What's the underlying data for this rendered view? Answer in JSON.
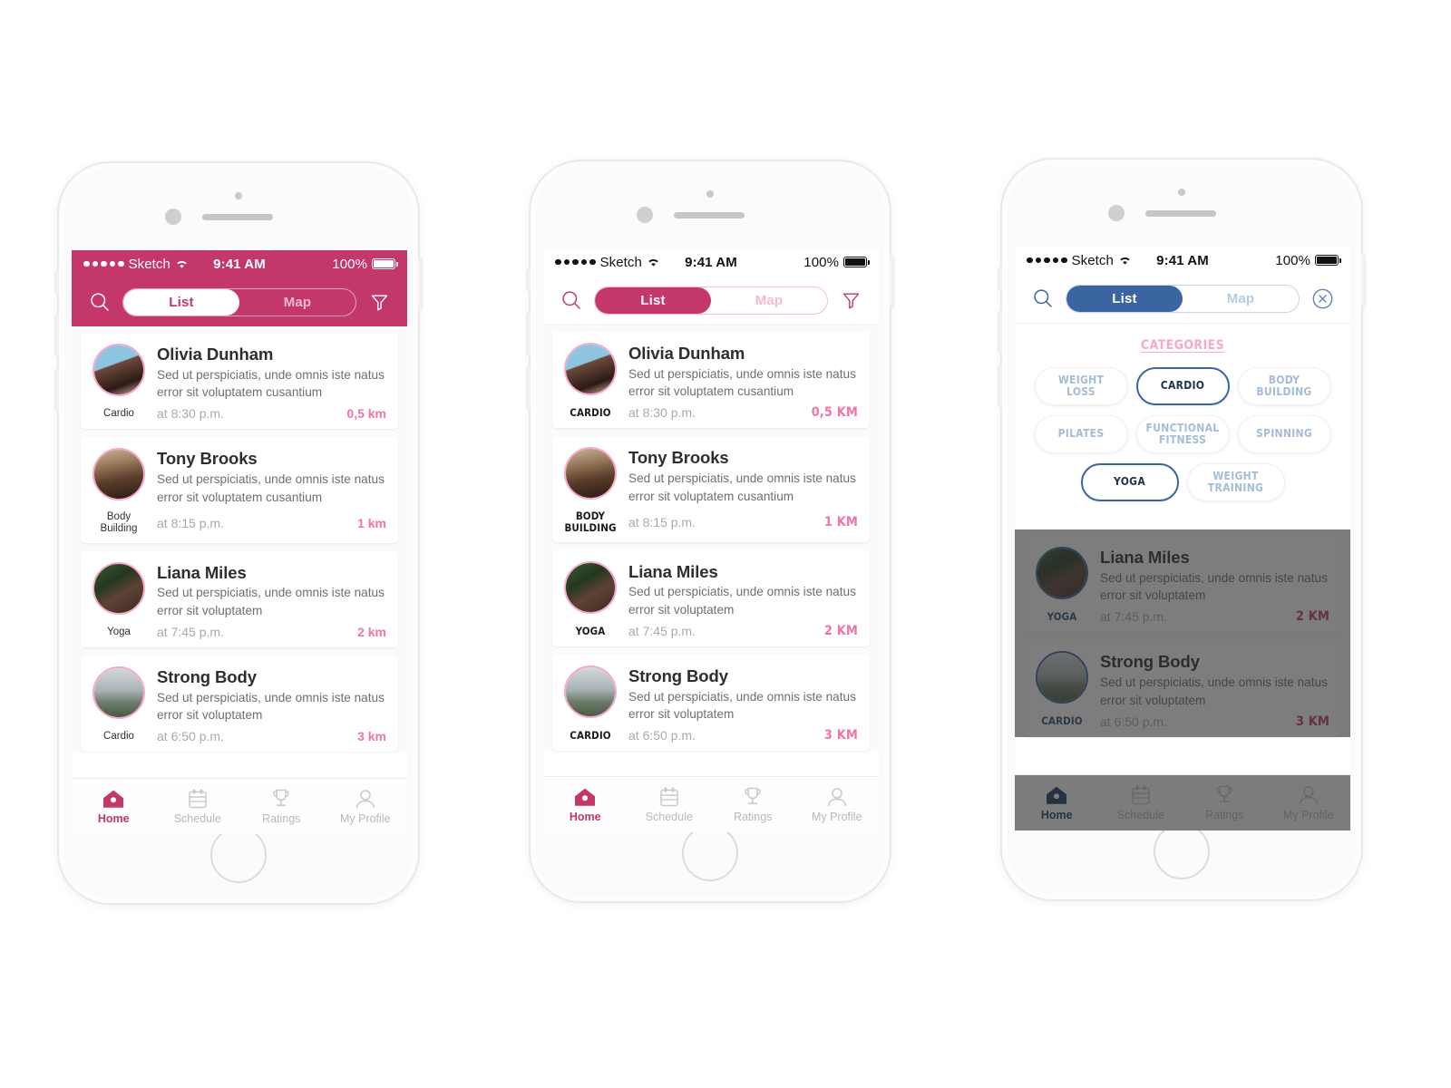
{
  "status_bar": {
    "carrier": "Sketch",
    "time": "9:41 AM",
    "battery_percent": "100%",
    "signal_dots": 5,
    "wifi_icon": "wifi-icon",
    "battery_icon": "battery-full-icon"
  },
  "nav": {
    "search_icon": "search-icon",
    "filter_icon": "filter-funnel-icon",
    "close_icon": "close-circle-icon",
    "segments": [
      {
        "label": "List",
        "active": true
      },
      {
        "label": "Map",
        "active": false
      }
    ]
  },
  "tabbar": {
    "items": [
      {
        "label": "Home",
        "icon": "home-icon",
        "active": true
      },
      {
        "label": "Schedule",
        "icon": "calendar-icon",
        "active": false
      },
      {
        "label": "Ratings",
        "icon": "trophy-icon",
        "active": false
      },
      {
        "label": "My Profile",
        "icon": "person-icon",
        "active": false
      }
    ]
  },
  "list": {
    "items": [
      {
        "name": "Olivia Dunham",
        "description": "Sed ut perspiciatis, unde omnis iste natus error sit voluptatem cusantium",
        "category": "Cardio",
        "category_upper": "CARDIO",
        "time": "at 8:30 p.m.",
        "distance": "0,5 km",
        "distance_upper": "0,5 KM",
        "avatar": "avatar-olivia"
      },
      {
        "name": "Tony Brooks",
        "description": "Sed ut perspiciatis, unde omnis iste natus error sit voluptatem cusantium",
        "category": "Body Building",
        "category_upper": "BODY BUILDING",
        "time": "at 8:15 p.m.",
        "distance": "1 km",
        "distance_upper": "1 KM",
        "avatar": "avatar-tony"
      },
      {
        "name": "Liana Miles",
        "description": "Sed ut perspiciatis, unde omnis iste natus error sit voluptatem",
        "category": "Yoga",
        "category_upper": "YOGA",
        "time": "at 7:45 p.m.",
        "distance": "2 km",
        "distance_upper": "2 KM",
        "avatar": "avatar-liana"
      },
      {
        "name": "Strong Body",
        "description": "Sed ut perspiciatis, unde omnis iste natus error sit voluptatem",
        "category": "Cardio",
        "category_upper": "CARDIO",
        "time": "at 6:50 p.m.",
        "distance": "3 km",
        "distance_upper": "3 KM",
        "avatar": "avatar-strongbody"
      }
    ]
  },
  "filter": {
    "title": "Categories",
    "rows": [
      [
        {
          "label": "Weight Loss",
          "selected": false
        },
        {
          "label": "Cardio",
          "selected": true
        },
        {
          "label": "Body Building",
          "selected": false
        }
      ],
      [
        {
          "label": "Pilates",
          "selected": false
        },
        {
          "label": "Functional Fitness",
          "selected": false
        },
        {
          "label": "Spinning",
          "selected": false
        }
      ],
      [
        {
          "label": "Yoga",
          "selected": true
        },
        {
          "label": "Weight Training",
          "selected": false
        }
      ]
    ]
  },
  "colors": {
    "magenta": "#c4376b",
    "pink_accent": "#f273a8",
    "pink_light": "#f8a8cc",
    "blue": "#3a65a0",
    "blue_muted": "#a6bcd6",
    "text_dark": "#2e2e2e",
    "text_muted": "#a9a9a9",
    "screen_bg": "#fafafa"
  }
}
